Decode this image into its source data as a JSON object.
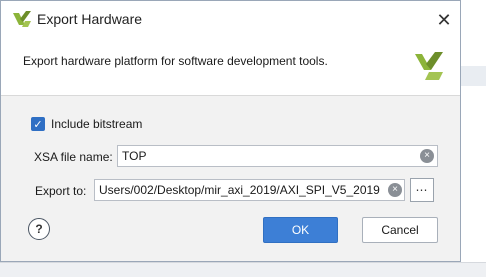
{
  "dialog": {
    "title": "Export Hardware",
    "close_glyph": "✕",
    "description": "Export hardware platform for software development tools.",
    "include_bitstream": {
      "label": "Include bitstream",
      "checked": true,
      "check_glyph": "✓"
    },
    "xsa_file_name": {
      "label": "XSA file name:",
      "value": "TOP"
    },
    "export_to": {
      "label": "Export to:",
      "value": "Users/002/Desktop/mir_axi_2019/AXI_SPI_V5_2019",
      "browse_label": "⋯"
    },
    "help_label": "?",
    "ok_label": "OK",
    "cancel_label": "Cancel",
    "clear_glyph": "×"
  },
  "colors": {
    "accent": "#3d7fd6",
    "logo_green": "#8cb43a",
    "logo_olive": "#6d8e2a"
  },
  "icons": {
    "app_logo": "vivado-logo-icon",
    "close": "close-icon",
    "clear": "clear-icon",
    "browse": "more-options-icon",
    "help": "help-icon"
  }
}
